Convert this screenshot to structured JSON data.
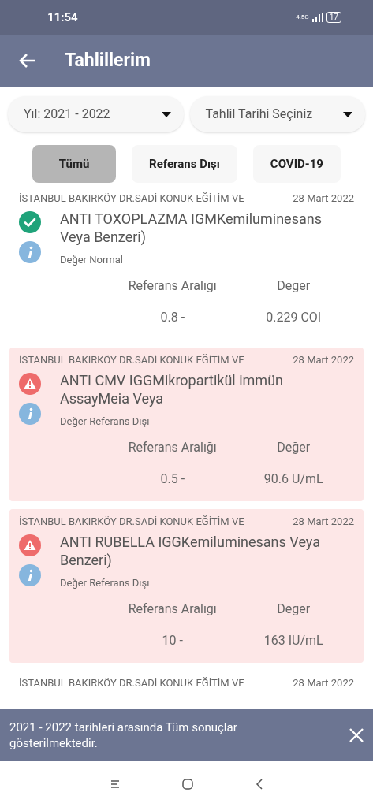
{
  "status_bar": {
    "time": "11:54",
    "network": "4.5G",
    "battery": "17"
  },
  "app_bar": {
    "title": "Tahlillerim"
  },
  "filters": [
    {
      "value": "Yıl: 2021 - 2022"
    },
    {
      "value": "Tahlil Tarihi Seçiniz"
    }
  ],
  "tabs": [
    {
      "label": "Tümü",
      "selected": true
    },
    {
      "label": "Referans Dışı",
      "selected": false
    },
    {
      "label": "COVID-19",
      "selected": false
    }
  ],
  "results": [
    {
      "hospital": "İSTANBUL BAKIRKÖY DR.SADİ KONUK EĞİTİM VE",
      "date": "28 Mart 2022",
      "kind": "normal",
      "name": "ANTI TOXOPLAZMA IGMKemiluminesans Veya Benzeri)",
      "status": "Değer Normal",
      "range_label": "Referans Aralığı",
      "value_label": "Değer",
      "range": "0.8 -",
      "value": "0.229 COI"
    },
    {
      "hospital": "İSTANBUL BAKIRKÖY DR.SADİ KONUK EĞİTİM VE",
      "date": "28 Mart 2022",
      "kind": "out_of_range",
      "name": "ANTI CMV IGGMikropartikül immün AssayMeia Veya",
      "status": "Değer Referans Dışı",
      "range_label": "Referans Aralığı",
      "value_label": "Değer",
      "range": "0.5 -",
      "value": "90.6 U/mL"
    },
    {
      "hospital": "İSTANBUL BAKIRKÖY DR.SADİ KONUK EĞİTİM VE",
      "date": "28 Mart 2022",
      "kind": "out_of_range",
      "name": "ANTI RUBELLA IGGKemiluminesans Veya Benzeri)",
      "status": "Değer Referans Dışı",
      "range_label": "Referans Aralığı",
      "value_label": "Değer",
      "range": "10 -",
      "value": "163 IU/mL"
    },
    {
      "hospital": "İSTANBUL BAKIRKÖY DR.SADİ KONUK EĞİTİM VE",
      "date": "28 Mart 2022",
      "kind": "normal"
    }
  ],
  "snackbar": {
    "message": "2021 - 2022 tarihleri arasında Tüm sonuçlar gösterilmektedir."
  }
}
